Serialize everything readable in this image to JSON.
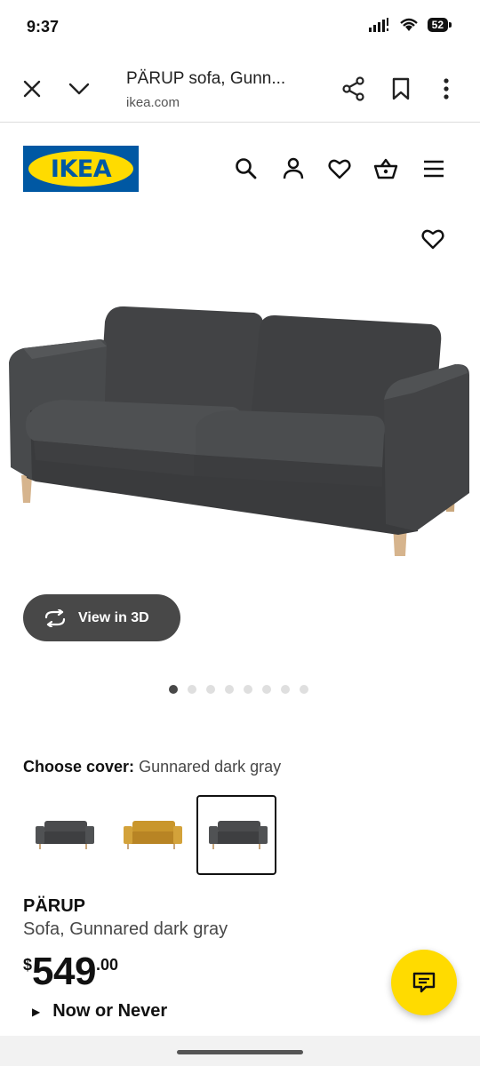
{
  "status": {
    "time": "9:37",
    "battery": "52"
  },
  "browser": {
    "title": "PÄRUP sofa, Gunn...",
    "domain": "ikea.com",
    "icons": [
      "close-icon",
      "chevron-down-icon",
      "share-icon",
      "bookmark-icon",
      "more-vertical-icon"
    ]
  },
  "header": {
    "logo_text": "IKEA",
    "icons": [
      "search-icon",
      "account-icon",
      "heart-icon",
      "basket-icon",
      "menu-icon"
    ],
    "colors": {
      "brand_blue": "#0058a3",
      "brand_yellow": "#ffdb00"
    }
  },
  "gallery": {
    "view3d_label": "View in 3D",
    "image_count": 8,
    "active_index": 0
  },
  "cover": {
    "label": "Choose cover:",
    "value": "Gunnared dark gray",
    "options": [
      {
        "name": "Gunnared dark gray",
        "color": "#4a4b4d",
        "selected": false
      },
      {
        "name": "yellow",
        "color": "#c9962c",
        "selected": false
      },
      {
        "name": "Gunnared dark gray",
        "color": "#4a4b4d",
        "selected": true
      }
    ]
  },
  "product": {
    "name": "PÄRUP",
    "description": "Sofa, Gunnared dark gray",
    "price_currency": "$",
    "price_integer": "549",
    "price_decimal": ".00",
    "promo": "Now or Never"
  }
}
